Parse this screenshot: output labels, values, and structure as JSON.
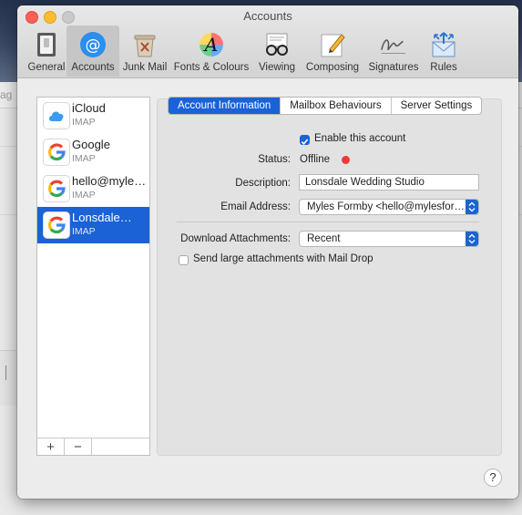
{
  "window": {
    "title": "Accounts"
  },
  "background": {
    "partial_text": "sag"
  },
  "toolbar": {
    "items": [
      {
        "label": "General",
        "icon": "general-switch-icon"
      },
      {
        "label": "Accounts",
        "icon": "at-sign-icon",
        "selected": true
      },
      {
        "label": "Junk Mail",
        "icon": "junk-bin-icon"
      },
      {
        "label": "Fonts & Colours",
        "icon": "font-color-icon"
      },
      {
        "label": "Viewing",
        "icon": "glasses-icon"
      },
      {
        "label": "Composing",
        "icon": "pencil-paper-icon"
      },
      {
        "label": "Signatures",
        "icon": "signature-icon"
      },
      {
        "label": "Rules",
        "icon": "rules-envelope-icon"
      }
    ]
  },
  "accounts": [
    {
      "name": "iCloud",
      "type": "IMAP",
      "icon": "icloud-icon"
    },
    {
      "name": "Google",
      "type": "IMAP",
      "icon": "google-g-icon"
    },
    {
      "name": "hello@myle…",
      "type": "IMAP",
      "icon": "google-g-icon"
    },
    {
      "name": "Lonsdale…",
      "type": "IMAP",
      "icon": "google-g-icon",
      "selected": true
    }
  ],
  "list_footer": {
    "add": "+",
    "remove": "−"
  },
  "tabs": [
    {
      "label": "Account Information",
      "selected": true
    },
    {
      "label": "Mailbox Behaviours"
    },
    {
      "label": "Server Settings"
    }
  ],
  "form": {
    "enable_label": "Enable this account",
    "enable_checked": true,
    "status_label": "Status:",
    "status_value": "Offline",
    "status_color": "#f03a3a",
    "description_label": "Description:",
    "description_value": "Lonsdale Wedding Studio",
    "email_label": "Email Address:",
    "email_value": "Myles Formby <hello@mylesfor…",
    "download_label": "Download Attachments:",
    "download_value": "Recent",
    "maildrop_label": "Send large attachments with Mail Drop",
    "maildrop_checked": false
  },
  "help": "?",
  "colors": {
    "accent": "#1a62d6"
  }
}
